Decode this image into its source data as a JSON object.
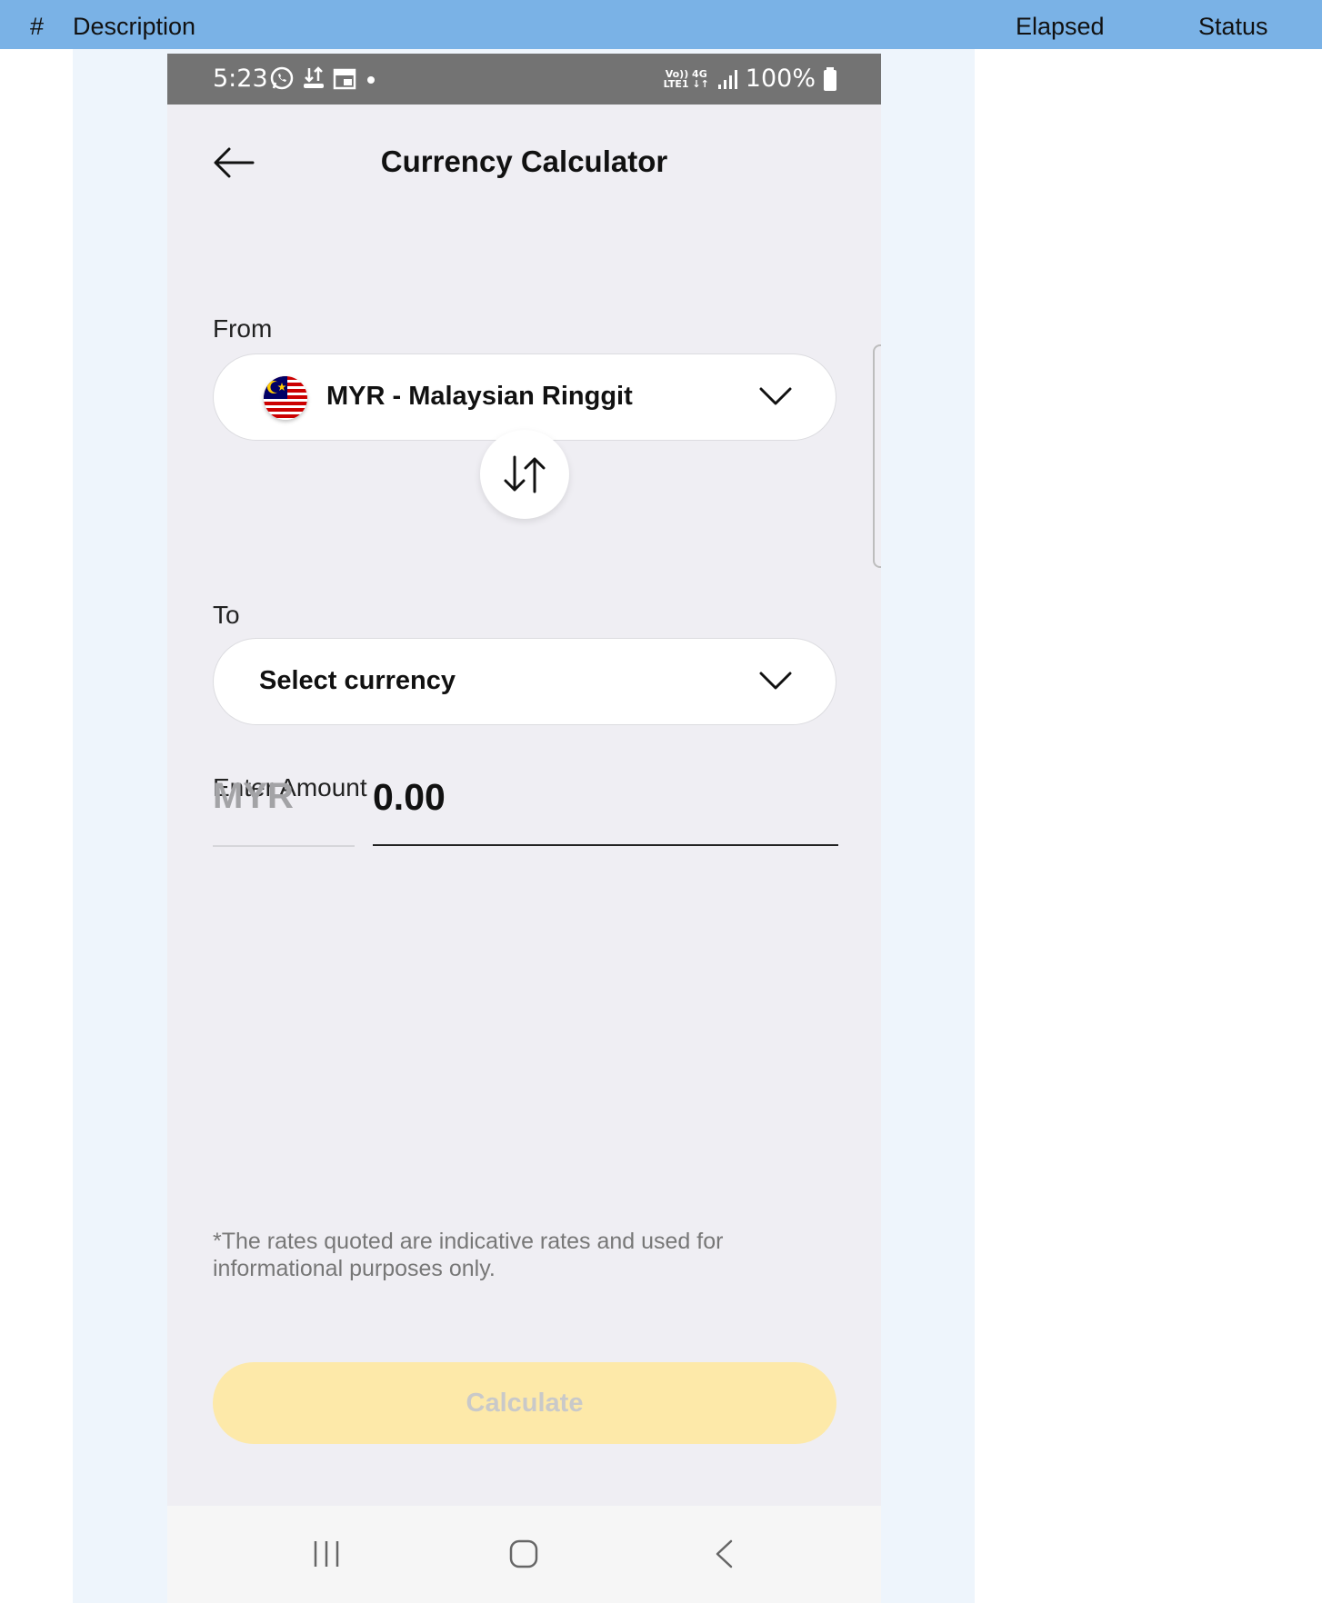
{
  "report": {
    "col_num": "#",
    "col_description": "Description",
    "col_elapsed": "Elapsed",
    "col_status": "Status"
  },
  "statusbar": {
    "time": "5:23",
    "network_top": "Vo)) 4G",
    "network_bottom": "LTE1 ↓↑",
    "battery": "100%"
  },
  "screen": {
    "title": "Currency Calculator",
    "from_label": "From",
    "from_currency": "MYR - Malaysian Ringgit",
    "to_label": "To",
    "to_placeholder": "Select currency",
    "amount_label": "Enter Amount",
    "amount_currency": "MYR",
    "amount_value": "0.00",
    "disclaimer": "*The rates quoted are indicative rates and used for informational purposes only.",
    "calculate_label": "Calculate"
  },
  "colors": {
    "header_blue": "#7ab2e6",
    "calculate_disabled": "#fde9a9",
    "statusbar": "#737373"
  },
  "icons": [
    "whatsapp-icon",
    "transfer-icon",
    "calendar-icon",
    "signal-icon",
    "battery-icon",
    "back-arrow-icon",
    "chevron-down-icon",
    "malaysia-flag-icon",
    "swap-icon",
    "recent-apps-icon",
    "home-icon",
    "nav-back-icon"
  ]
}
